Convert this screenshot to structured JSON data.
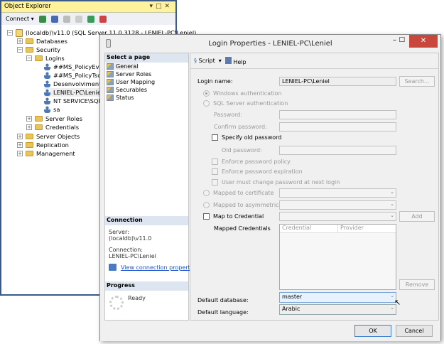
{
  "object_explorer": {
    "title": "Object Explorer",
    "connect_label": "Connect",
    "server": "(localdb)\\v11.0 (SQL Server 11.0.3128 - LENIEL-PC\\Leniel)",
    "nodes": {
      "databases": "Databases",
      "security": "Security",
      "logins": "Logins",
      "server_roles": "Server Roles",
      "credentials": "Credentials",
      "server_objects": "Server Objects",
      "replication": "Replication",
      "management": "Management"
    },
    "logins": [
      "##MS_PolicyEventProcessingLogin##",
      "##MS_PolicyTsqlExecutionLogin##",
      "Desenvolvimento",
      "LENIEL-PC\\Leniel",
      "NT SERVICE\\SQLWriter",
      "sa"
    ]
  },
  "dialog": {
    "title": "Login Properties - LENIEL-PC\\Leniel",
    "select_page": "Select a page",
    "pages": [
      "General",
      "Server Roles",
      "User Mapping",
      "Securables",
      "Status"
    ],
    "toolbar": {
      "script": "Script",
      "help": "Help"
    },
    "connection": {
      "header": "Connection",
      "server_label": "Server:",
      "server": "(localdb)\\v11.0",
      "connection_label": "Connection:",
      "connection": "LENIEL-PC\\Leniel",
      "view_link": "View connection properties"
    },
    "progress": {
      "header": "Progress",
      "status": "Ready"
    },
    "form": {
      "login_name_label": "Login name:",
      "login_name": "LENIEL-PC\\Leniel",
      "search": "Search...",
      "windows_auth": "Windows authentication",
      "sql_auth": "SQL Server authentication",
      "password": "Password:",
      "confirm_password": "Confirm password:",
      "specify_old": "Specify old password",
      "old_password": "Old password:",
      "enforce_policy": "Enforce password policy",
      "enforce_expiration": "Enforce password expiration",
      "must_change": "User must change password at next login",
      "mapped_cert": "Mapped to certificate",
      "mapped_asym": "Mapped to asymmetric key",
      "map_credential": "Map to Credential",
      "add": "Add",
      "mapped_credentials": "Mapped Credentials",
      "col_credential": "Credential",
      "col_provider": "Provider",
      "remove": "Remove",
      "default_db_label": "Default database:",
      "default_db": "master",
      "default_lang_label": "Default language:",
      "default_lang": "Arabic"
    },
    "ok": "OK",
    "cancel": "Cancel"
  }
}
